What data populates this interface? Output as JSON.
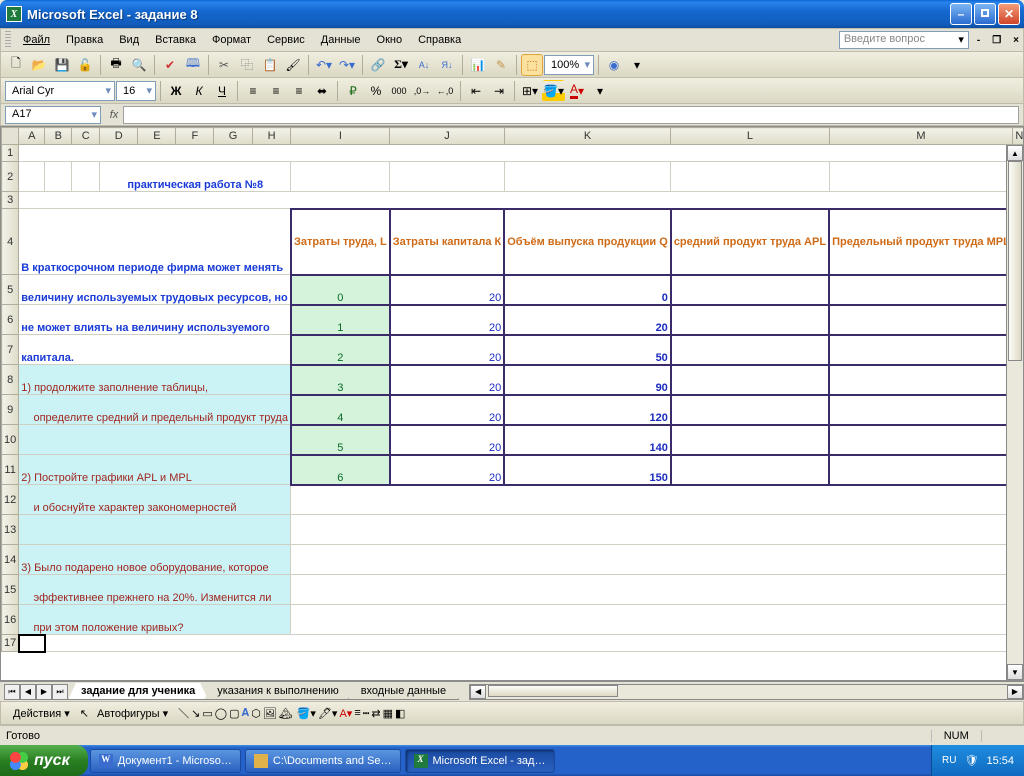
{
  "window": {
    "title": "Microsoft Excel - задание 8"
  },
  "menu": [
    "Файл",
    "Правка",
    "Вид",
    "Вставка",
    "Формат",
    "Сервис",
    "Данные",
    "Окно",
    "Справка"
  ],
  "question_placeholder": "Введите вопрос",
  "toolbar": {
    "font": "Arial Cyr",
    "size": "16",
    "zoom": "100%"
  },
  "namebox": "A17",
  "columns": [
    "A",
    "B",
    "C",
    "D",
    "E",
    "F",
    "G",
    "H",
    "I",
    "J",
    "K",
    "L",
    "M",
    "N"
  ],
  "cells": {
    "title": "практическая работа №8",
    "p1": "В краткосрочном периоде фирма может менять",
    "p2": "величину используемых трудовых ресурсов, но",
    "p3": "не может влиять на величину используемого",
    "p4": "капитала.",
    "t1": "1) продолжите заполнение таблицы,",
    "t1b": "    определите средний и предельный продукт труда",
    "t2": "2) Постройте графики APL и MPL",
    "t2b": "    и обоснуйте характер закономерностей",
    "t3": "3) Было подарено новое оборудование, которое",
    "t3b": "    эффективнее прежнего на 20%. Изменится ли",
    "t3c": "    при этом положение кривых?",
    "h_I": "Затраты труда, L",
    "h_J": "Затраты капитала К",
    "h_K": "Объём выпуска продукции Q",
    "h_L": "средний продукт труда APL",
    "h_M": "Предельный продукт труда MPL"
  },
  "data_rows": [
    {
      "L": "0",
      "K": "20",
      "Q": "0"
    },
    {
      "L": "1",
      "K": "20",
      "Q": "20"
    },
    {
      "L": "2",
      "K": "20",
      "Q": "50"
    },
    {
      "L": "3",
      "K": "20",
      "Q": "90"
    },
    {
      "L": "4",
      "K": "20",
      "Q": "120"
    },
    {
      "L": "5",
      "K": "20",
      "Q": "140"
    },
    {
      "L": "6",
      "K": "20",
      "Q": "150"
    }
  ],
  "sheets": [
    "задание для ученика",
    "указания к выполнению",
    "входные данные"
  ],
  "drawing": {
    "actions": "Действия",
    "autoshapes": "Автофигуры"
  },
  "status": {
    "ready": "Готово",
    "num": "NUM"
  },
  "taskbar": {
    "start": "пуск",
    "items": [
      "Документ1 - Microso…",
      "C:\\Documents and Se…",
      "Microsoft Excel - зад…"
    ],
    "lang": "RU",
    "time": "15:54"
  }
}
